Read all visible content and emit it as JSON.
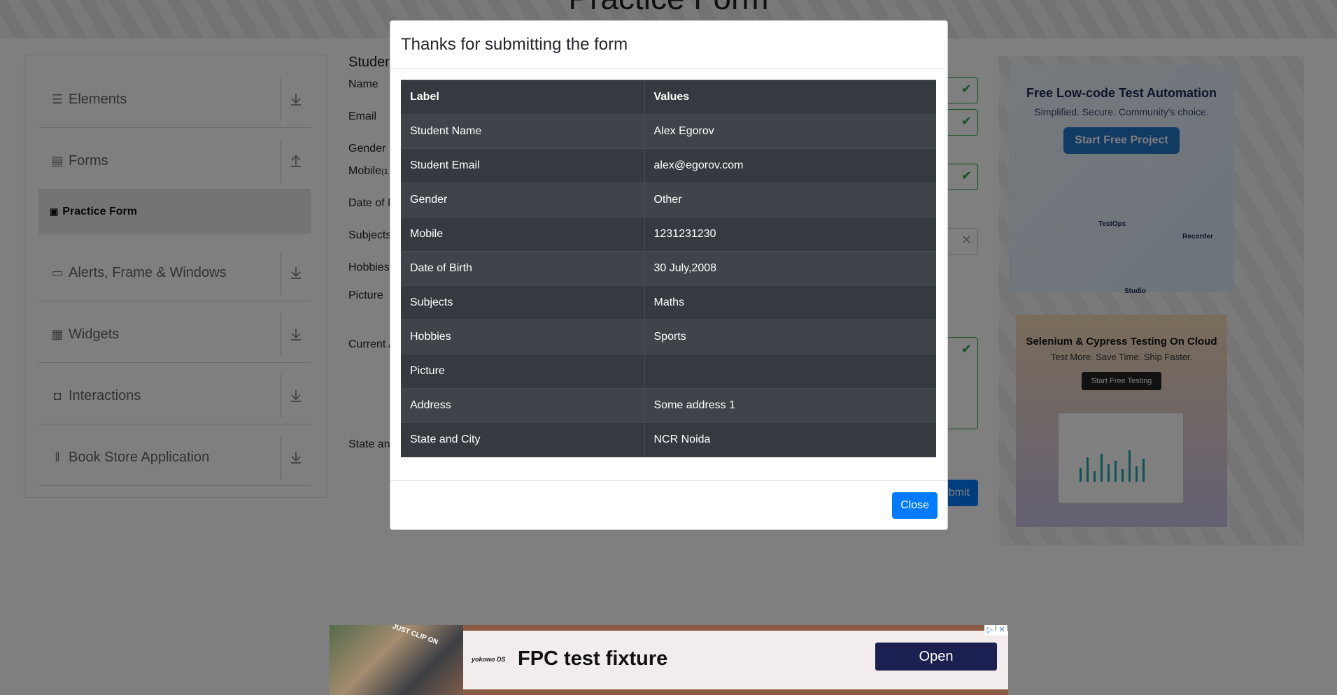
{
  "page": {
    "title": "Practice Form"
  },
  "sidebar": {
    "groups": [
      {
        "label": "Elements",
        "icon": "menu-icon",
        "arrow": "download-arrow-icon"
      },
      {
        "label": "Forms",
        "icon": "document-icon",
        "arrow": "upload-arrow-icon"
      },
      {
        "label": "Alerts, Frame & Windows",
        "icon": "window-icon",
        "arrow": "download-arrow-icon"
      },
      {
        "label": "Widgets",
        "icon": "widgets-icon",
        "arrow": "download-arrow-icon"
      },
      {
        "label": "Interactions",
        "icon": "interactions-icon",
        "arrow": "download-arrow-icon"
      },
      {
        "label": "Book Store Application",
        "icon": "books-icon",
        "arrow": "download-arrow-icon"
      }
    ],
    "active_item": "Practice Form"
  },
  "form": {
    "heading": "Studen",
    "labels": {
      "name": "Name",
      "email": "Email",
      "gender": "Gender",
      "mobile": "Mobile",
      "mobile_suffix": "(1",
      "dob": "Date of B",
      "subjects": "Subjects",
      "hobbies": "Hobbies",
      "picture": "Picture",
      "address": "Current A",
      "state": "State an"
    },
    "submit_label": "bmit"
  },
  "ads": {
    "card1": {
      "title": "Free Low-code Test Automation",
      "subtitle": "Simplified. Secure. Community's choice.",
      "button": "Start Free Project",
      "labels": [
        "TestOps",
        "Recorder",
        "Studio"
      ]
    },
    "card2": {
      "title": "Selenium & Cypress Testing On Cloud",
      "subtitle": "Test More. Save Time. Ship Faster.",
      "button": "Start Free Testing"
    },
    "bottom": {
      "thumb_text": "JUST CLIP ON",
      "brand": "yokowo DS",
      "headline": "FPC test fixture",
      "button": "Open"
    }
  },
  "modal": {
    "title": "Thanks for submitting the form",
    "columns": [
      "Label",
      "Values"
    ],
    "rows": [
      [
        "Student Name",
        "Alex Egorov"
      ],
      [
        "Student Email",
        "alex@egorov.com"
      ],
      [
        "Gender",
        "Other"
      ],
      [
        "Mobile",
        "1231231230"
      ],
      [
        "Date of Birth",
        "30 July,2008"
      ],
      [
        "Subjects",
        "Maths"
      ],
      [
        "Hobbies",
        "Sports"
      ],
      [
        "Picture",
        ""
      ],
      [
        "Address",
        "Some address 1"
      ],
      [
        "State and City",
        "NCR Noida"
      ]
    ],
    "close_label": "Close"
  }
}
